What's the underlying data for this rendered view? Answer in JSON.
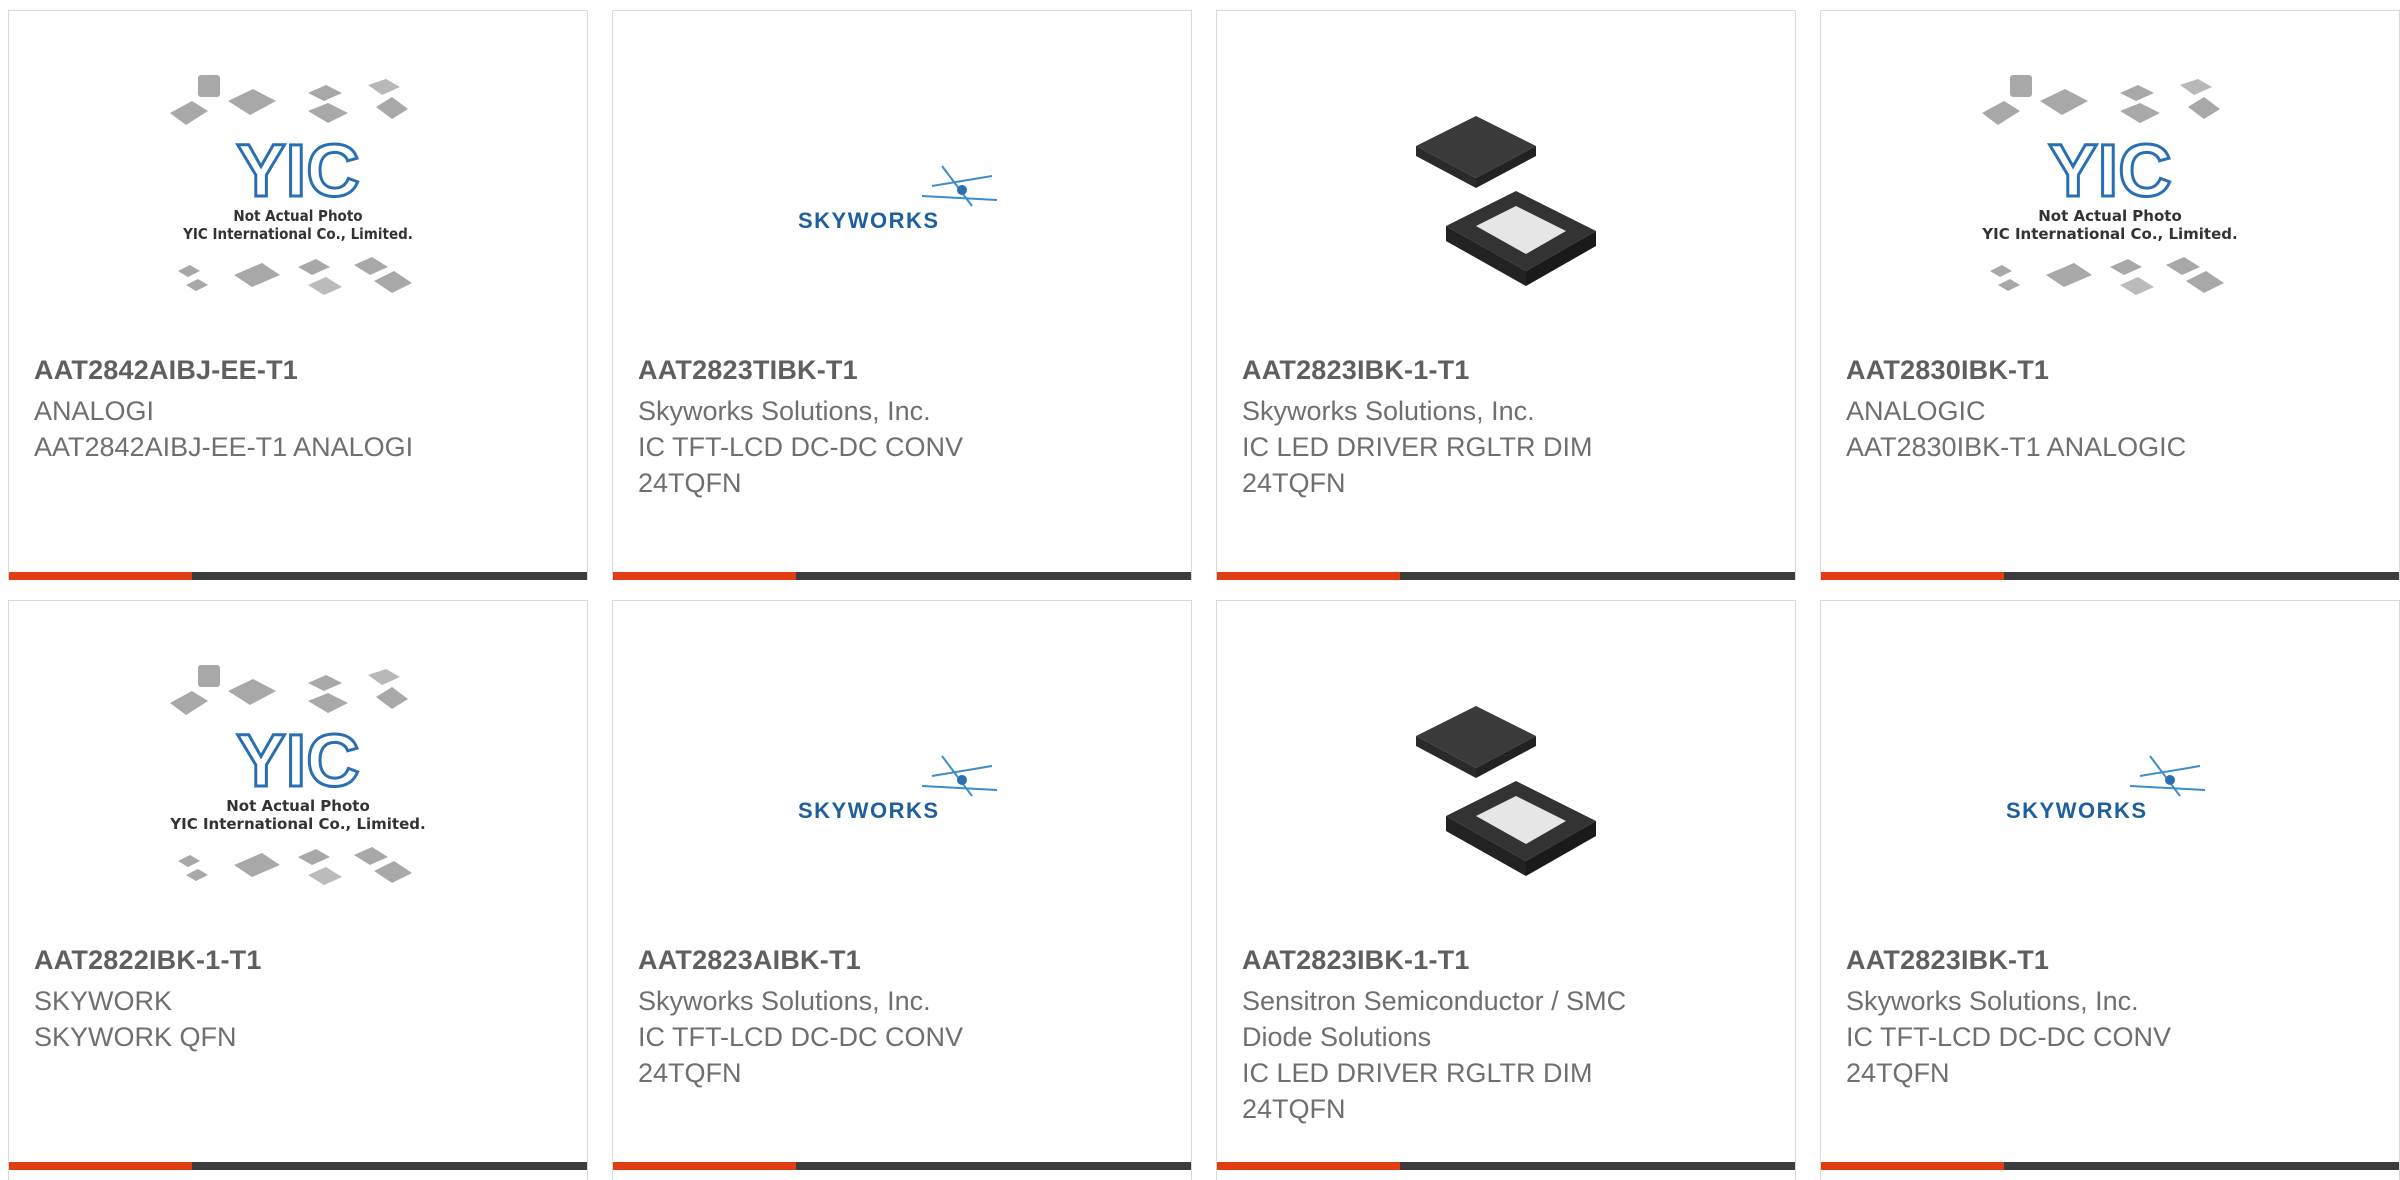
{
  "cards": [
    {
      "title": "AAT2842AIBJ-EE-T1",
      "lines": [
        "ANALOGI",
        "AAT2842AIBJ-EE-T1 ANALOGI"
      ],
      "image": "yic-placeholder-icon",
      "image_caption": [
        "Not Actual Photo",
        "YIC International Co., Limited."
      ],
      "image_logo": "YIC"
    },
    {
      "title": "AAT2823TIBK-T1",
      "lines": [
        "Skyworks Solutions, Inc.",
        "IC TFT-LCD DC-DC CONV",
        "24TQFN"
      ],
      "image": "skyworks-logo-icon",
      "image_logo": "SKYWORKS"
    },
    {
      "title": "AAT2823IBK-1-T1",
      "lines": [
        "Skyworks Solutions, Inc.",
        "IC LED DRIVER RGLTR DIM",
        "24TQFN"
      ],
      "image": "qfn-chip-icon"
    },
    {
      "title": "AAT2830IBK-T1",
      "lines": [
        "ANALOGIC",
        "AAT2830IBK-T1 ANALOGIC"
      ],
      "image": "yic-placeholder-icon",
      "image_caption": [
        "Not Actual Photo",
        "YIC International Co., Limited."
      ],
      "image_logo": "YIC"
    },
    {
      "title": "AAT2822IBK-1-T1",
      "lines": [
        "SKYWORK",
        "SKYWORK QFN"
      ],
      "image": "yic-placeholder-icon",
      "image_caption": [
        "Not Actual Photo",
        "YIC International Co., Limited."
      ],
      "image_logo": "YIC"
    },
    {
      "title": "AAT2823AIBK-T1",
      "lines": [
        "Skyworks Solutions, Inc.",
        "IC TFT-LCD DC-DC CONV",
        "24TQFN"
      ],
      "image": "skyworks-logo-icon",
      "image_logo": "SKYWORKS"
    },
    {
      "title": "AAT2823IBK-1-T1",
      "lines": [
        "Sensitron Semiconductor / SMC",
        "Diode Solutions",
        "IC LED DRIVER RGLTR DIM",
        "24TQFN"
      ],
      "image": "qfn-chip-icon"
    },
    {
      "title": "AAT2823IBK-T1",
      "lines": [
        "Skyworks Solutions, Inc.",
        "IC TFT-LCD DC-DC CONV",
        "24TQFN"
      ],
      "image": "skyworks-logo-icon",
      "image_logo": "SKYWORKS"
    }
  ],
  "colors": {
    "accent": "#e23d12",
    "bar": "#3c3c3c",
    "title": "#5f5f5f",
    "text": "#6f6f6f",
    "logo_blue": "#1e5f9e"
  }
}
